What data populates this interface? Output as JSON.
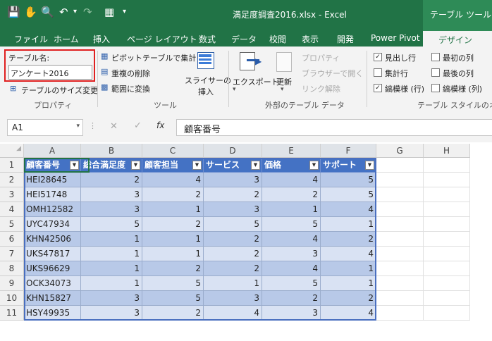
{
  "titlebar": {
    "doc_title": "満足度調査2016.xlsx - Excel",
    "context_tools": "テーブル ツール"
  },
  "tabs": [
    "ファイル",
    "ホーム",
    "挿入",
    "ページ レイアウト",
    "数式",
    "データ",
    "校閲",
    "表示",
    "開発",
    "Power Pivot"
  ],
  "active_tab": "デザイン",
  "ribbon": {
    "table_name_label": "テーブル名:",
    "table_name_value": "アンケート2016",
    "resize_table": "テーブルのサイズ変更",
    "group_properties": "プロパティ",
    "pivot_summary": "ピボットテーブルで集計",
    "remove_duplicates": "重複の削除",
    "convert_range": "範囲に変換",
    "group_tools": "ツール",
    "insert_slicer": [
      "スライサーの",
      "挿入"
    ],
    "export": "エクスポート",
    "refresh": "更新",
    "properties_btn": "プロパティ",
    "open_browser": "ブラウザーで開く",
    "unlink": "リンク解除",
    "group_external": "外部のテーブル データ",
    "opt_header_row": "見出し行",
    "opt_total_row": "集計行",
    "opt_banded_rows": "縞模様 (行)",
    "opt_first_col": "最初の列",
    "opt_last_col": "最後の列",
    "opt_banded_cols": "縞模様 (列)",
    "group_style_options": "テーブル スタイルのオプ"
  },
  "formula_bar": {
    "name_box": "A1",
    "fx": "fx",
    "content": "顧客番号"
  },
  "columns": [
    "A",
    "B",
    "C",
    "D",
    "E",
    "F",
    "G",
    "H"
  ],
  "table": {
    "headers": [
      "顧客番号",
      "総合満足度",
      "顧客担当",
      "サービス",
      "価格",
      "サポート"
    ],
    "rows": [
      [
        "HEI28645",
        "2",
        "4",
        "3",
        "4",
        "5"
      ],
      [
        "HEI51748",
        "3",
        "2",
        "2",
        "2",
        "5"
      ],
      [
        "OMH12582",
        "3",
        "1",
        "3",
        "1",
        "4"
      ],
      [
        "UYC47934",
        "5",
        "2",
        "5",
        "5",
        "1"
      ],
      [
        "KHN42506",
        "1",
        "1",
        "2",
        "4",
        "2"
      ],
      [
        "UKS47817",
        "1",
        "1",
        "2",
        "3",
        "4"
      ],
      [
        "UKS96629",
        "1",
        "2",
        "2",
        "4",
        "1"
      ],
      [
        "OCK34073",
        "1",
        "5",
        "1",
        "5",
        "1"
      ],
      [
        "KHN15827",
        "3",
        "5",
        "3",
        "2",
        "2"
      ],
      [
        "HSY49935",
        "3",
        "2",
        "4",
        "3",
        "4"
      ]
    ]
  },
  "row_numbers": [
    "1",
    "2",
    "3",
    "4",
    "5",
    "6",
    "7",
    "8",
    "9",
    "10",
    "11"
  ]
}
